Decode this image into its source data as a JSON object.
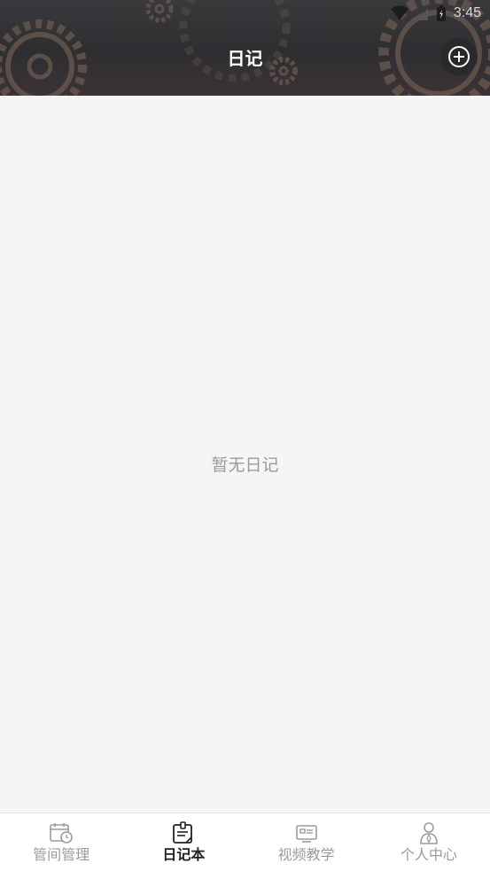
{
  "status_bar": {
    "time": "3:45"
  },
  "header": {
    "title": "日记"
  },
  "main": {
    "empty_text": "暂无日记"
  },
  "tabbar": {
    "tabs": [
      {
        "label": "管间管理",
        "icon": "calendar-clock-icon",
        "active": false
      },
      {
        "label": "日记本",
        "icon": "notebook-icon",
        "active": true
      },
      {
        "label": "视频教学",
        "icon": "video-screen-icon",
        "active": false
      },
      {
        "label": "个人中心",
        "icon": "person-icon",
        "active": false
      }
    ]
  },
  "colors": {
    "header_bg": "#333336",
    "gear": "#6b5a50",
    "page_bg": "#f5f5f5",
    "active_tab": "#222222",
    "inactive_tab": "#9b9b9b"
  }
}
